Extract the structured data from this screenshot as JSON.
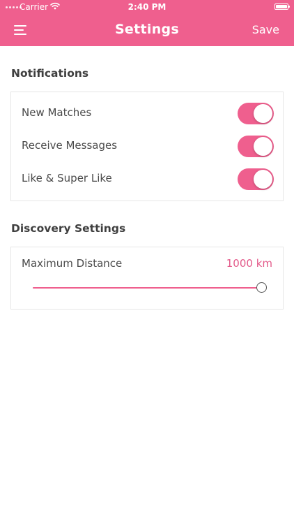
{
  "status_bar": {
    "carrier": "Carrier",
    "time": "2:40 PM",
    "battery_level": 1.0
  },
  "nav": {
    "title": "Settings",
    "save_label": "Save",
    "menu_icon": "menu-icon"
  },
  "notifications": {
    "title": "Notifications",
    "items": [
      {
        "label": "New Matches",
        "enabled": true
      },
      {
        "label": "Receive Messages",
        "enabled": true
      },
      {
        "label": "Like & Super Like",
        "enabled": true
      }
    ]
  },
  "discovery": {
    "title": "Discovery Settings",
    "max_distance_label": "Maximum Distance",
    "max_distance_value": "1000 km",
    "slider_fraction": 1.0
  },
  "colors": {
    "accent": "#ef5f8e",
    "accent_text": "#e35a8a",
    "text": "#4a4a4a",
    "heading": "#3f3f3f",
    "border": "#e6e6e6"
  }
}
